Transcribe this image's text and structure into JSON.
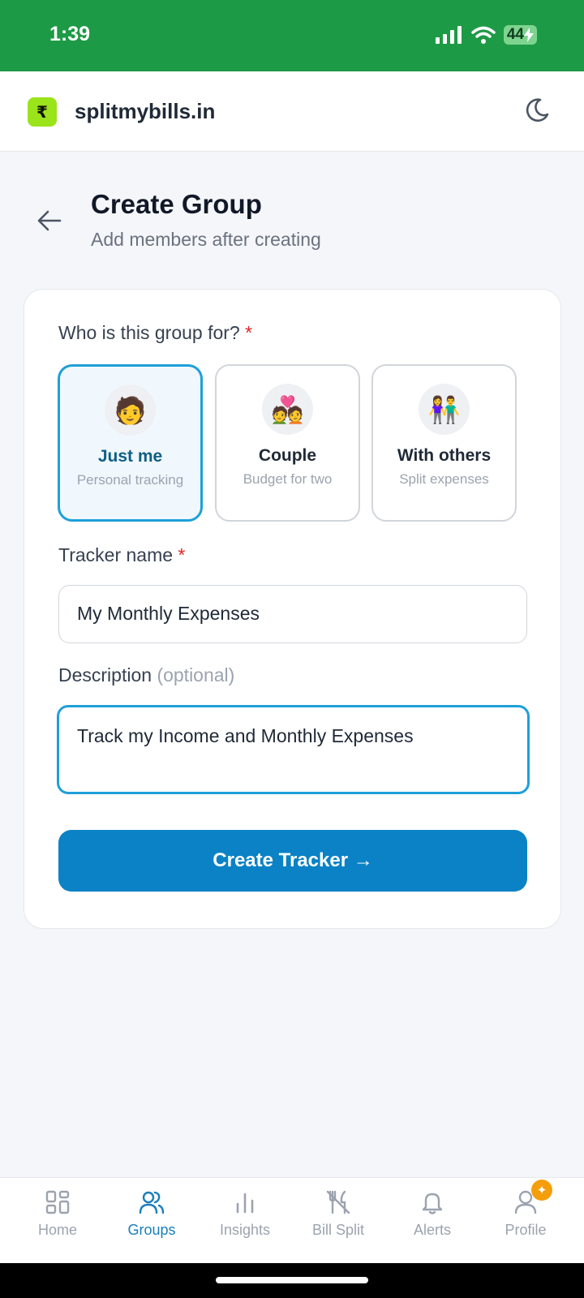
{
  "status_bar": {
    "time": "1:39",
    "battery": "44"
  },
  "app_bar": {
    "brand": "splitmybills.in",
    "logo_symbol": "₹",
    "theme_icon": "moon-icon"
  },
  "header": {
    "title": "Create Group",
    "subtitle": "Add members after creating"
  },
  "form": {
    "who_label": "Who is this group for?",
    "required_mark": "*",
    "options": [
      {
        "emoji": "🧑",
        "title": "Just me",
        "subtitle": "Personal tracking",
        "selected": true
      },
      {
        "emoji": "💑",
        "title": "Couple",
        "subtitle": "Budget for two",
        "selected": false
      },
      {
        "emoji": "👫",
        "title": "With others",
        "subtitle": "Split expenses",
        "selected": false
      }
    ],
    "name_label": "Tracker name",
    "name_value": "My Monthly Expenses",
    "description_label": "Description",
    "description_optional": "(optional)",
    "description_value": "Track my Income and Monthly Expenses",
    "submit_label": "Create Tracker →"
  },
  "bottom_nav": {
    "items": [
      {
        "label": "Home",
        "icon": "grid-icon",
        "active": false
      },
      {
        "label": "Groups",
        "icon": "users-icon",
        "active": true
      },
      {
        "label": "Insights",
        "icon": "bar-chart-icon",
        "active": false
      },
      {
        "label": "Bill Split",
        "icon": "utensils-off-icon",
        "active": false
      },
      {
        "label": "Alerts",
        "icon": "bell-icon",
        "active": false
      },
      {
        "label": "Profile",
        "icon": "user-icon",
        "active": false
      }
    ]
  },
  "colors": {
    "status_bar": "#1d9a45",
    "accent": "#0a82c5",
    "selected_border": "#1ea0d9",
    "logo": "#9be31a"
  }
}
